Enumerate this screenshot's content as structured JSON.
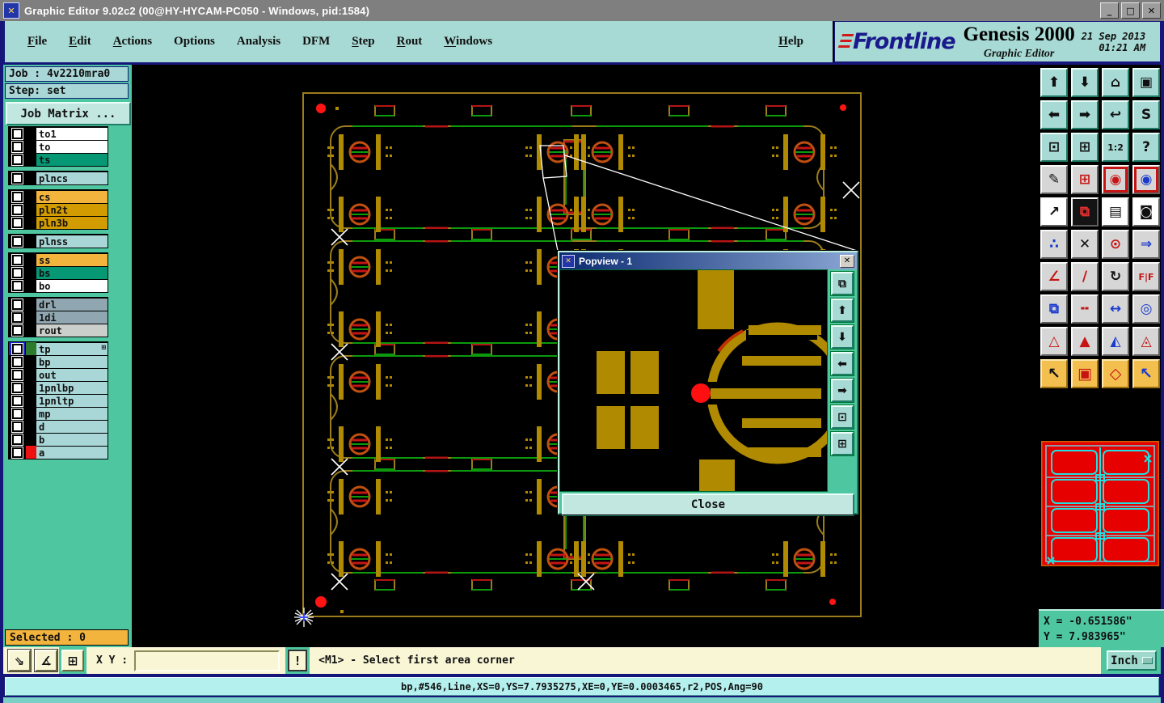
{
  "window": {
    "title": "Graphic Editor 9.02c2 (00@HY-HYCAM-PC050 - Windows, pid:1584)",
    "icon_glyph": "✕",
    "controls": [
      {
        "name": "minimize-button",
        "glyph": "_"
      },
      {
        "name": "maximize-button",
        "glyph": "□"
      },
      {
        "name": "close-button",
        "glyph": "✕"
      }
    ]
  },
  "menu": {
    "items": [
      {
        "label": "File",
        "underline": 0
      },
      {
        "label": "Edit",
        "underline": 0
      },
      {
        "label": "Actions",
        "underline": 0
      },
      {
        "label": "Options",
        "underline": -1
      },
      {
        "label": "Analysis",
        "underline": -1
      },
      {
        "label": "DFM",
        "underline": -1
      },
      {
        "label": "Step",
        "underline": 0
      },
      {
        "label": "Rout",
        "underline": 0
      },
      {
        "label": "Windows",
        "underline": 0
      }
    ],
    "help": {
      "label": "Help",
      "underline": 0
    }
  },
  "brand": {
    "logo": "Frontline",
    "product": "Genesis 2000",
    "subtitle": "Graphic Editor",
    "date": "21 Sep 2013",
    "time": "01:21 AM"
  },
  "job_panel": {
    "job_label": "Job : 4v2210mra0",
    "step_label": "Step: set",
    "matrix_button": "Job Matrix ...",
    "selected_label": "Selected : 0",
    "layer_groups": [
      {
        "layers": [
          {
            "name": "to1",
            "bg": "#ffffff"
          },
          {
            "name": "to",
            "bg": "#ffffff"
          },
          {
            "name": "ts",
            "bg": "#069875"
          }
        ]
      },
      {
        "layers": [
          {
            "name": "plncs",
            "bg": "#a9d6d6"
          }
        ]
      },
      {
        "layers": [
          {
            "name": "cs",
            "bg": "#f3b43e"
          },
          {
            "name": "pln2t",
            "bg": "#d29b00"
          },
          {
            "name": "pln3b",
            "bg": "#d29b00"
          }
        ]
      },
      {
        "layers": [
          {
            "name": "plnss",
            "bg": "#a9d6d6"
          }
        ]
      },
      {
        "layers": [
          {
            "name": "ss",
            "bg": "#f3b43e"
          },
          {
            "name": "bs",
            "bg": "#069875"
          },
          {
            "name": "bo",
            "bg": "#ffffff"
          }
        ]
      },
      {
        "layers": [
          {
            "name": "drl",
            "bg": "#90a7b1"
          },
          {
            "name": "1di",
            "bg": "#90a7b1"
          },
          {
            "name": "rout",
            "bg": "#cbcfcb"
          }
        ]
      },
      {
        "layers": [
          {
            "name": "tp",
            "bg": "#a9d6d6",
            "active": true,
            "swatch": "#2d7a2d",
            "expander": "⊞"
          },
          {
            "name": "bp",
            "bg": "#a9d6d6"
          },
          {
            "name": "out",
            "bg": "#a9d6d6"
          },
          {
            "name": "1pnlbp",
            "bg": "#a9d6d6"
          },
          {
            "name": "1pnltp",
            "bg": "#a9d6d6"
          },
          {
            "name": "mp",
            "bg": "#a9d6d6"
          },
          {
            "name": "d",
            "bg": "#a9d6d6"
          },
          {
            "name": "b",
            "bg": "#a9d6d6"
          },
          {
            "name": "a",
            "bg": "#a9d6d6",
            "swatch": "#ee1111"
          }
        ]
      }
    ]
  },
  "right_toolbar": {
    "buttons": [
      {
        "name": "zoom-in-button",
        "icon": "zoom-in-icon",
        "glyph": "⬆",
        "cls": "teal"
      },
      {
        "name": "zoom-out-button",
        "icon": "zoom-out-icon",
        "glyph": "⬇",
        "cls": "teal"
      },
      {
        "name": "home-view-button",
        "icon": "home-icon",
        "glyph": "⌂",
        "cls": "teal"
      },
      {
        "name": "window-xy-button",
        "icon": "window-xy-icon",
        "glyph": "▣",
        "cls": "teal"
      },
      {
        "name": "pan-left-button",
        "icon": "pan-left-icon",
        "glyph": "⬅",
        "cls": "teal"
      },
      {
        "name": "pan-right-button",
        "icon": "pan-right-icon",
        "glyph": "➡",
        "cls": "teal"
      },
      {
        "name": "previous-view-button",
        "icon": "previous-view-icon",
        "glyph": "↩",
        "cls": "teal"
      },
      {
        "name": "profile-button",
        "icon": "profile-icon",
        "glyph": "S",
        "cls": "teal"
      },
      {
        "name": "zoom-extents-button",
        "icon": "zoom-extents-icon",
        "glyph": "⊡",
        "cls": "teal"
      },
      {
        "name": "zoom-fit-button",
        "icon": "zoom-fit-icon",
        "glyph": "⊞",
        "cls": "teal"
      },
      {
        "name": "scale-1-2-button",
        "icon": "scale-ratio-icon",
        "glyph": "1:2",
        "cls": "teal small"
      },
      {
        "name": "help-button",
        "icon": "help-icon",
        "glyph": "?",
        "cls": "teal"
      },
      {
        "name": "edit-attributes-button",
        "icon": "pencil-palette-icon",
        "glyph": "✎",
        "cls": "gray"
      },
      {
        "name": "snap-grid-button",
        "icon": "grid-dot-icon",
        "glyph": "⊞",
        "cls": "gray",
        "fg": "#c61414"
      },
      {
        "name": "highlight-net-button",
        "icon": "net-dots-icon",
        "glyph": "◉",
        "cls": "grayred",
        "fg": "#c61414"
      },
      {
        "name": "highlight-net-alt-button",
        "icon": "net-dots-alt-icon",
        "glyph": "◉",
        "cls": "grayred",
        "fg": "#1a3acc"
      },
      {
        "name": "move-button",
        "icon": "move-arrow-icon",
        "glyph": "↗",
        "cls": "white"
      },
      {
        "name": "copy-button",
        "icon": "copy-squares-icon",
        "glyph": "⧉",
        "cls": "black"
      },
      {
        "name": "measure-ruler-button",
        "icon": "ruler-icon",
        "glyph": "▤",
        "cls": "white"
      },
      {
        "name": "select-symbol-button",
        "icon": "dashed-circle-icon",
        "glyph": "◙",
        "cls": "white"
      },
      {
        "name": "net-endpoints-button",
        "icon": "blue-net-icon",
        "glyph": "∴",
        "cls": "gray",
        "fg": "#1a3acc"
      },
      {
        "name": "delete-button",
        "icon": "delete-x-icon",
        "glyph": "✕",
        "cls": "gray"
      },
      {
        "name": "resize-pad-button",
        "icon": "grow-circle-icon",
        "glyph": "⊙",
        "cls": "gray",
        "fg": "#c61414"
      },
      {
        "name": "change-symbol-button",
        "icon": "swap-dot-icon",
        "glyph": "⇒",
        "cls": "gray",
        "fg": "#1a3acc"
      },
      {
        "name": "angle-button",
        "icon": "angle-icon",
        "glyph": "∠",
        "cls": "gray",
        "fg": "#c61414"
      },
      {
        "name": "slant-line-button",
        "icon": "slant-line-icon",
        "glyph": "∕",
        "cls": "gray",
        "fg": "#c61414"
      },
      {
        "name": "rotate-button",
        "icon": "rotate-arrow-icon",
        "glyph": "↻",
        "cls": "gray"
      },
      {
        "name": "mirror-button",
        "icon": "mirror-ff-icon",
        "glyph": "F|F",
        "cls": "gray small",
        "fg": "#c61414"
      },
      {
        "name": "copy-to-layer-button",
        "icon": "layer-copy-icon",
        "glyph": "⧉",
        "cls": "gray",
        "fg": "#1a3acc"
      },
      {
        "name": "break-line-button",
        "icon": "dashed-line-icon",
        "glyph": "╍",
        "cls": "gray",
        "fg": "#c61414"
      },
      {
        "name": "line-width-button",
        "icon": "width-measure-icon",
        "glyph": "↔",
        "cls": "gray",
        "fg": "#1a3acc"
      },
      {
        "name": "touching-button",
        "icon": "overlap-circles-icon",
        "glyph": "◎",
        "cls": "gray",
        "fg": "#1a3acc"
      },
      {
        "name": "contourize-button",
        "icon": "triangle-icon",
        "glyph": "△",
        "cls": "gray",
        "fg": "#c61414"
      },
      {
        "name": "contour-fill-button",
        "icon": "triangle-fill-icon",
        "glyph": "▲",
        "cls": "gray",
        "fg": "#c61414"
      },
      {
        "name": "contour-outline-button",
        "icon": "triangle-open-icon",
        "glyph": "◭",
        "cls": "gray",
        "fg": "#1a3acc"
      },
      {
        "name": "contour-base-button",
        "icon": "triangle-base-icon",
        "glyph": "◬",
        "cls": "gray",
        "fg": "#c61414"
      },
      {
        "name": "select-tool-button",
        "icon": "cursor-arrow-icon",
        "glyph": "↖",
        "cls": "yellow"
      },
      {
        "name": "select-inside-box-button",
        "icon": "cursor-box-icon",
        "glyph": "▣",
        "cls": "yellow",
        "fg": "#c61414"
      },
      {
        "name": "select-inside-polygon-button",
        "icon": "cursor-polygon-icon",
        "glyph": "◇",
        "cls": "yellow",
        "fg": "#c61414"
      },
      {
        "name": "select-net-button",
        "icon": "cursor-net-icon",
        "glyph": "↖",
        "cls": "yellow",
        "fg": "#1a3acc"
      }
    ]
  },
  "popview": {
    "title": "Popview - 1",
    "icon_glyph": "✕",
    "close_x": "✕",
    "close_button": "Close",
    "tools": [
      {
        "name": "popview-restore-button",
        "icon": "window-restore-icon",
        "glyph": "⧉"
      },
      {
        "name": "popview-zoom-in-button",
        "icon": "zoom-in-icon",
        "glyph": "⬆"
      },
      {
        "name": "popview-zoom-out-button",
        "icon": "zoom-out-icon",
        "glyph": "⬇"
      },
      {
        "name": "popview-pan-left-button",
        "icon": "pan-left-icon",
        "glyph": "⬅"
      },
      {
        "name": "popview-pan-right-button",
        "icon": "pan-right-icon",
        "glyph": "➡"
      },
      {
        "name": "popview-zoom-extents-button",
        "icon": "zoom-extents-icon",
        "glyph": "⊡"
      },
      {
        "name": "popview-zoom-fit-button",
        "icon": "zoom-fit-icon",
        "glyph": "⊞"
      }
    ]
  },
  "coords": {
    "x_readout": "X = -0.651586\"",
    "y_readout": "Y = 7.983965\""
  },
  "command_bar": {
    "tools": [
      {
        "name": "pointer-mode-button",
        "icon": "diagonal-arrow-icon",
        "glyph": "⇘",
        "cls": ""
      },
      {
        "name": "angle-mode-button",
        "icon": "angle-alpha-icon",
        "glyph": "∡",
        "cls": ""
      },
      {
        "name": "grid-toggle-button",
        "icon": "grid-window-icon",
        "glyph": "⊞",
        "cls": "tealframe"
      }
    ],
    "xy_label": "X Y :",
    "input_value": "",
    "bang_button": "!",
    "prompt": "<M1> - Select first area corner",
    "units": "Inch"
  },
  "status_bar": {
    "text": "bp,#546,Line,XS=0,YS=7.7935275,XE=0,YE=0.0003465,r2,POS,Ang=90"
  },
  "colors": {
    "menu_teal": "#a7dad4",
    "panel_teal": "#4ec7a1",
    "navy": "#16167a",
    "command_yellow": "#f9f6d6",
    "status_cyan": "#b4f0ee",
    "selected_orange": "#f3b43e",
    "board_olive": "#9a7d1c",
    "trace_green": "#0c9a0c",
    "trace_red": "#b41414",
    "fiducial_red": "#ff1414",
    "pad_gold": "#b08a00",
    "overview_red": "#e60000",
    "overview_cyan": "#20e0e0"
  }
}
